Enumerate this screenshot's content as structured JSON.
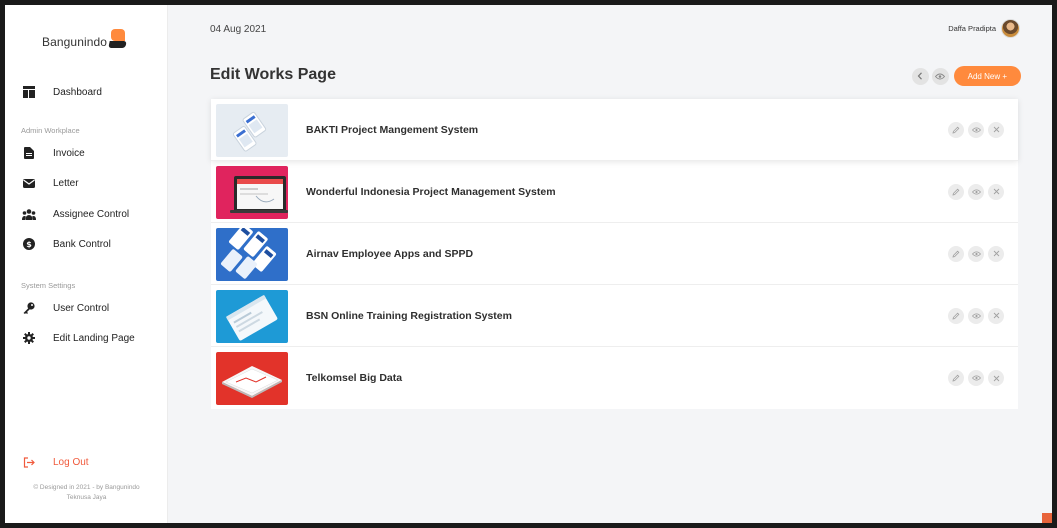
{
  "brand": {
    "name": "Bangunindo"
  },
  "header": {
    "date": "04 Aug 2021",
    "user_name": "Daffa Pradipta"
  },
  "sidebar": {
    "dashboard": {
      "label": "Dashboard",
      "icon": "dashboard-icon"
    },
    "admin_title": "Admin Workplace",
    "admin_items": [
      {
        "label": "Invoice",
        "icon": "invoice-icon"
      },
      {
        "label": "Letter",
        "icon": "envelope-icon"
      },
      {
        "label": "Assignee Control",
        "icon": "users-icon"
      },
      {
        "label": "Bank Control",
        "icon": "dollar-icon"
      }
    ],
    "settings_title": "System Settings",
    "settings_items": [
      {
        "label": "User Control",
        "icon": "key-icon"
      },
      {
        "label": "Edit Landing Page",
        "icon": "gear-icon"
      }
    ],
    "logout": {
      "label": "Log Out",
      "icon": "logout-icon"
    },
    "copyright_line1": "© Designed in 2021 - by Bangunindo",
    "copyright_line2": "Teknusa Jaya"
  },
  "page": {
    "title": "Edit Works Page",
    "back_icon": "chevron-left-icon",
    "view_icon": "eye-icon",
    "add_label": "Add New +"
  },
  "works": [
    {
      "title": "BAKTI Project Mangement System",
      "thumb_color": "#e6ecf2"
    },
    {
      "title": "Wonderful Indonesia Project Management System",
      "thumb_color": "#e0245e"
    },
    {
      "title": "Airnav Employee Apps and SPPD",
      "thumb_color": "#2f6fc9"
    },
    {
      "title": "BSN Online Training Registration System",
      "thumb_color": "#1e9ad6"
    },
    {
      "title": "Telkomsel Big Data",
      "thumb_color": "#e2332a"
    }
  ],
  "row_actions": {
    "edit_icon": "pencil-icon",
    "view_icon": "eye-icon",
    "delete_icon": "close-icon"
  },
  "colors": {
    "accent": "#ff8a3d",
    "logout": "#f05a3c"
  }
}
